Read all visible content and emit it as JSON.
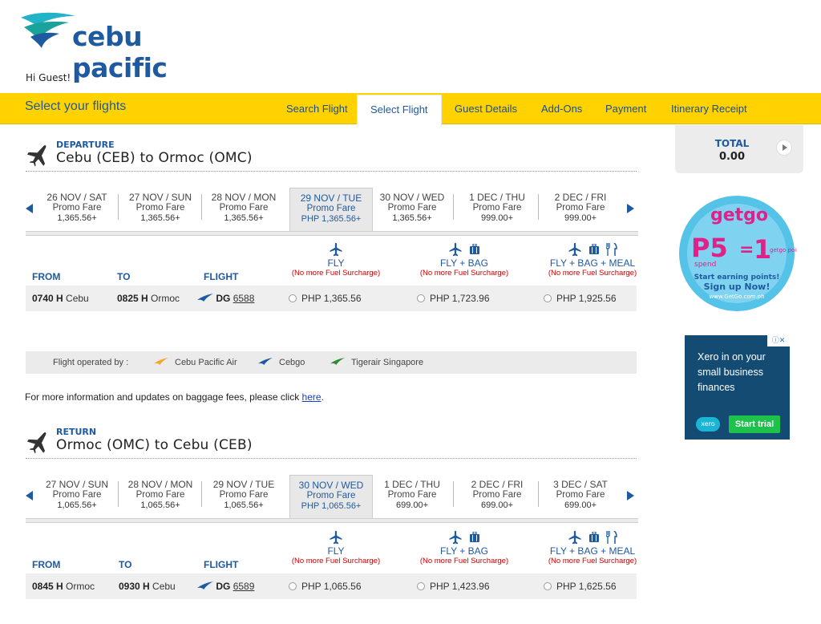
{
  "brand": {
    "name": "cebu pacific",
    "color": "#1f5aa0",
    "accent": "#ffd200"
  },
  "greeting": "Hi Guest!",
  "toolbar": {
    "title": "Select your flights",
    "steps": [
      "Search Flight",
      "Select Flight",
      "Guest Details",
      "Add-Ons",
      "Payment",
      "Itinerary Receipt"
    ]
  },
  "sidebar": {
    "total_label": "TOTAL",
    "total_value": "0.00"
  },
  "departure": {
    "kind": "DEPARTURE",
    "route": "Cebu  (CEB)  to  Ormoc  (OMC)",
    "dates": [
      {
        "date": "26 NOV / SAT",
        "fare": "Promo Fare",
        "price": "1,365.56+"
      },
      {
        "date": "27 NOV / SUN",
        "fare": "Promo Fare",
        "price": "1,365.56+"
      },
      {
        "date": "28 NOV / MON",
        "fare": "Promo Fare",
        "price": "1,365.56+"
      },
      {
        "date": "29 NOV / TUE",
        "fare": "Promo Fare",
        "price": "PHP 1,365.56+"
      },
      {
        "date": "30 NOV / WED",
        "fare": "Promo Fare",
        "price": "1,365.56+"
      },
      {
        "date": "1 DEC / THU",
        "fare": "Promo Fare",
        "price": "999.00+"
      },
      {
        "date": "2 DEC / FRI",
        "fare": "Promo Fare",
        "price": "999.00+"
      }
    ],
    "columns": {
      "from": "FROM",
      "to": "TO",
      "flight": "FLIGHT"
    },
    "bundles": [
      {
        "name": "FLY",
        "note": "(No more Fuel Surcharge)"
      },
      {
        "name": "FLY + BAG",
        "note": "(No more Fuel Surcharge)"
      },
      {
        "name": "FLY + BAG + MEAL",
        "note": "(No more Fuel Surcharge)"
      }
    ],
    "flight": {
      "dep_time": "0740 H",
      "dep_city": "Cebu",
      "arr_time": "0825 H",
      "arr_city": "Ormoc",
      "carrier": "DG",
      "number": "6588",
      "prices": [
        "PHP 1,365.56",
        "PHP 1,723.96",
        "PHP 1,925.56"
      ]
    }
  },
  "operators": {
    "label": "Flight operated by :",
    "list": [
      {
        "name": "Cebu Pacific Air",
        "color": "#f5a623"
      },
      {
        "name": "Cebgo",
        "color": "#1f5aa0"
      },
      {
        "name": "Tigerair Singapore",
        "color": "#2e8b2e"
      }
    ]
  },
  "info": {
    "text": "For more information and updates on baggage fees, please click ",
    "link": "here",
    "end": "."
  },
  "return": {
    "kind": "RETURN",
    "route": "Ormoc  (OMC) to  Cebu  (CEB)",
    "dates": [
      {
        "date": "27 NOV / SUN",
        "fare": "Promo Fare",
        "price": "1,065.56+"
      },
      {
        "date": "28 NOV / MON",
        "fare": "Promo Fare",
        "price": "1,065.56+"
      },
      {
        "date": "29 NOV / TUE",
        "fare": "Promo Fare",
        "price": "1,065.56+"
      },
      {
        "date": "30 NOV / WED",
        "fare": "Promo Fare",
        "price": "PHP 1,065.56+"
      },
      {
        "date": "1 DEC / THU",
        "fare": "Promo Fare",
        "price": "699.00+"
      },
      {
        "date": "2 DEC / FRI",
        "fare": "Promo Fare",
        "price": "699.00+"
      },
      {
        "date": "3 DEC / SAT",
        "fare": "Promo Fare",
        "price": "699.00+"
      }
    ],
    "columns": {
      "from": "FROM",
      "to": "TO",
      "flight": "FLIGHT"
    },
    "bundles": [
      {
        "name": "FLY",
        "note": "(No more Fuel Surcharge)"
      },
      {
        "name": "FLY + BAG",
        "note": "(No more Fuel Surcharge)"
      },
      {
        "name": "FLY + BAG + MEAL",
        "note": "(No more Fuel Surcharge)"
      }
    ],
    "flight": {
      "dep_time": "0845 H",
      "dep_city": "Ormoc",
      "arr_time": "0930 H",
      "arr_city": "Cebu",
      "carrier": "DG",
      "number": "6589",
      "prices": [
        "PHP 1,065.56",
        "PHP 1,423.96",
        "PHP 1,625.56"
      ]
    }
  },
  "ads": {
    "getgo": {
      "brand": "getgo",
      "headline": "P5",
      "spend": "spend",
      "eq": "=",
      "one": "1",
      "point": "getgo point",
      "line1": "Start earning points!",
      "line2": "Sign up Now!",
      "site": "www.GetGo.com.ph"
    },
    "xero": {
      "text": "Xero in on your small business finances",
      "logo": "xero",
      "cta": "Start trial"
    }
  }
}
